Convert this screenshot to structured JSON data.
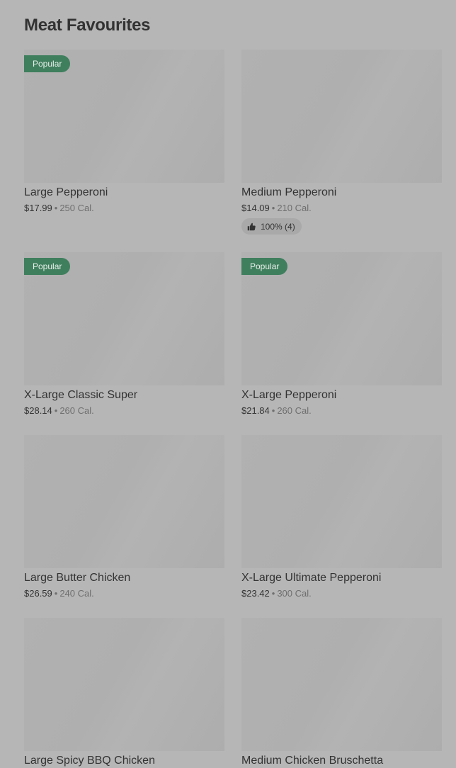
{
  "section": {
    "title": "Meat Favourites"
  },
  "items": [
    {
      "name": "Large Pepperoni",
      "price": "$17.99",
      "separator": "•",
      "calories": "250 Cal.",
      "badge": "Popular"
    },
    {
      "name": "Medium Pepperoni",
      "price": "$14.09",
      "separator": "•",
      "calories": "210 Cal.",
      "rating": "100% (4)",
      "rating_icon": "thumbs-up-icon"
    },
    {
      "name": "X-Large Classic Super",
      "price": "$28.14",
      "separator": "•",
      "calories": "260 Cal.",
      "badge": "Popular"
    },
    {
      "name": "X-Large Pepperoni",
      "price": "$21.84",
      "separator": "•",
      "calories": "260 Cal.",
      "badge": "Popular"
    },
    {
      "name": "Large Butter Chicken",
      "price": "$26.59",
      "separator": "•",
      "calories": "240 Cal."
    },
    {
      "name": "X-Large Ultimate Pepperoni",
      "price": "$23.42",
      "separator": "•",
      "calories": "300 Cal."
    },
    {
      "name": "Large Spicy BBQ Chicken"
    },
    {
      "name": "Medium Chicken Bruschetta"
    }
  ],
  "colors": {
    "background": "#b6b6b6",
    "badge": "#3f7f5e",
    "image_placeholder": "#b0b0b0",
    "rating_pill": "#a9a9a9"
  }
}
